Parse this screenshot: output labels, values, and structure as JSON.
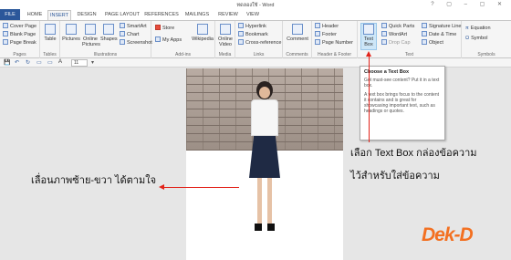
{
  "window": {
    "title": "ทดลองใช้ - Word"
  },
  "tabs": [
    "FILE",
    "HOME",
    "INSERT",
    "DESIGN",
    "PAGE LAYOUT",
    "REFERENCES",
    "MAILINGS",
    "REVIEW",
    "VIEW"
  ],
  "ribbon": {
    "pages": {
      "label": "Pages",
      "items": [
        "Cover Page",
        "Blank Page",
        "Page Break"
      ]
    },
    "tables": {
      "label": "Tables",
      "button": "Table"
    },
    "illustrations": {
      "label": "Illustrations",
      "pictures": "Pictures",
      "online_pictures": "Online Pictures",
      "shapes": "Shapes",
      "smartart": "SmartArt",
      "chart": "Chart",
      "screenshot": "Screenshot"
    },
    "addins": {
      "label": "Add-ins",
      "store": "Store",
      "my_apps": "My Apps",
      "wikipedia": "Wikipedia"
    },
    "media": {
      "label": "Media",
      "online_video": "Online Video"
    },
    "links": {
      "label": "Links",
      "hyperlink": "Hyperlink",
      "bookmark": "Bookmark",
      "cross_reference": "Cross-reference"
    },
    "comments": {
      "label": "Comments",
      "comment": "Comment"
    },
    "header_footer": {
      "label": "Header & Footer",
      "header": "Header",
      "footer": "Footer",
      "page_number": "Page Number"
    },
    "text": {
      "label": "Text",
      "text_box": "Text Box",
      "quick_parts": "Quick Parts",
      "wordart": "WordArt",
      "drop_cap": "Drop Cap",
      "signature_line": "Signature Line",
      "date_time": "Date & Time",
      "object": "Object"
    },
    "symbols": {
      "label": "Symbols",
      "equation": "Equation",
      "symbol": "Symbol"
    }
  },
  "qat": {
    "font_size": "11"
  },
  "tooltip": {
    "title": "Choose a Text Box",
    "line1": "Got must-see content? Put it in a text box.",
    "line2": "A text box brings focus to the content it contains and is great for showcasing important text, such as headings or quotes."
  },
  "annotations": {
    "left_caption": "เลื่อนภาพซ้าย-ขวา ได้ตามใจ",
    "right_caption_1": "เลือก Text Box กล่องข้อความ",
    "right_caption_2": "ไว้สำหรับใส่ข้อความ"
  },
  "logo": {
    "text": "Dek-D"
  },
  "colors": {
    "accent": "#2b579a",
    "arrow": "#e2231a",
    "logo": "#f37021"
  }
}
